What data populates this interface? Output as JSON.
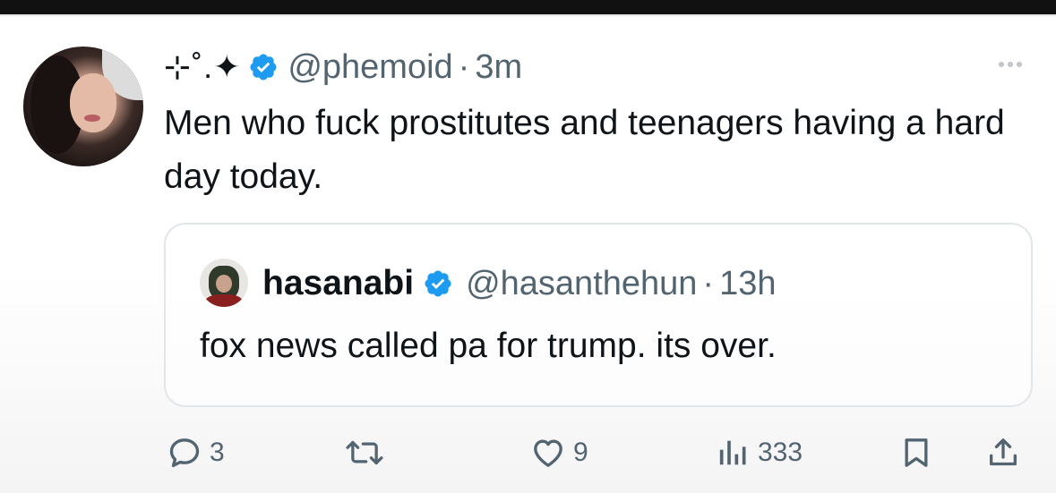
{
  "tweet": {
    "display_name": "⊹˚.✦",
    "handle": "@phemoid",
    "separator": "·",
    "time": "3m",
    "text": "Men who fuck prostitutes and teenagers having a hard day today.",
    "verified": true
  },
  "quote": {
    "display_name": "hasanabi",
    "handle": "@hasanthehun",
    "separator": "·",
    "time": "13h",
    "text": "fox news called pa for trump. its over.",
    "verified": true
  },
  "actions": {
    "reply_count": "3",
    "repost_count": "",
    "like_count": "9",
    "view_count": "333"
  },
  "colors": {
    "verified_blue": "#1d9bf0",
    "secondary_text": "#536471",
    "primary_text": "#0f1419",
    "border": "#e1e6ea"
  },
  "icons": {
    "more": "ellipsis-icon",
    "reply": "speech-bubble-icon",
    "repost": "repost-arrows-icon",
    "like": "heart-icon",
    "views": "bar-chart-icon",
    "bookmark": "bookmark-icon",
    "share": "share-upload-icon"
  }
}
